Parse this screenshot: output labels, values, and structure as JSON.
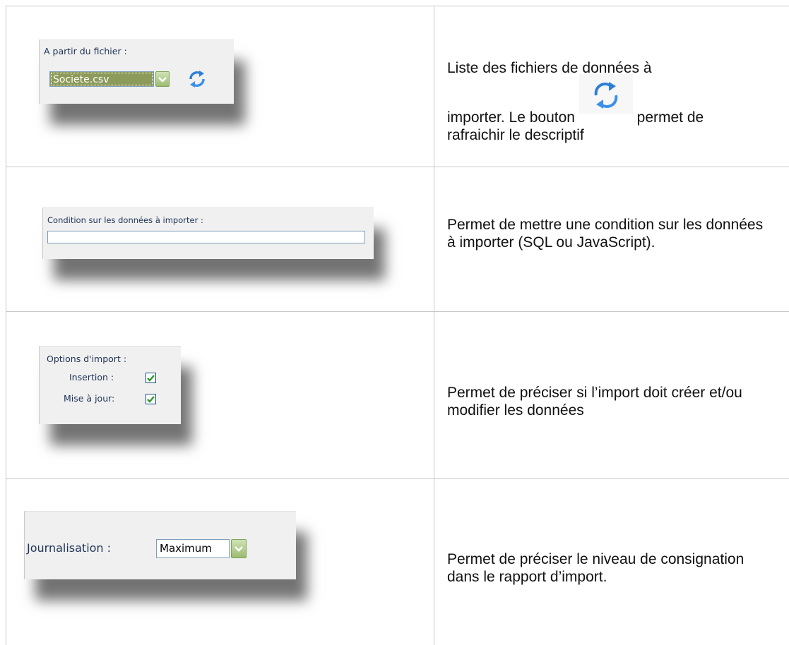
{
  "rows": [
    {
      "screenshot": {
        "label": "A partir du fichier :",
        "combo_value": "Societe.csv",
        "icon": "refresh-icon"
      },
      "description": {
        "part1": "Liste des fichiers de données à",
        "part2": "importer. Le bouton",
        "part3": "permet de",
        "part4": "rafraichir le descriptif"
      }
    },
    {
      "screenshot": {
        "label": "Condition sur les données à importer :",
        "input_value": ""
      },
      "description": {
        "text": "Permet de mettre une condition sur les données à importer (SQL ou JavaScript)."
      }
    },
    {
      "screenshot": {
        "label": "Options d'import :",
        "insertion_label": "Insertion :",
        "insertion_checked": true,
        "update_label": "Mise à jour:",
        "update_checked": true
      },
      "description": {
        "text": "Permet de préciser si l’import doit créer et/ou modifier les données"
      }
    },
    {
      "screenshot": {
        "label": "Journalisation :",
        "combo_value": "Maximum"
      },
      "description": {
        "text": "Permet de préciser le niveau de consignation dans le rapport d’import."
      }
    }
  ],
  "colors": {
    "grid": "#c8c8c8",
    "panel": "#f0f0f0",
    "label": "#1e3357",
    "refresh_blue": "#2f7fd6",
    "check_green": "#2a9a2a"
  }
}
